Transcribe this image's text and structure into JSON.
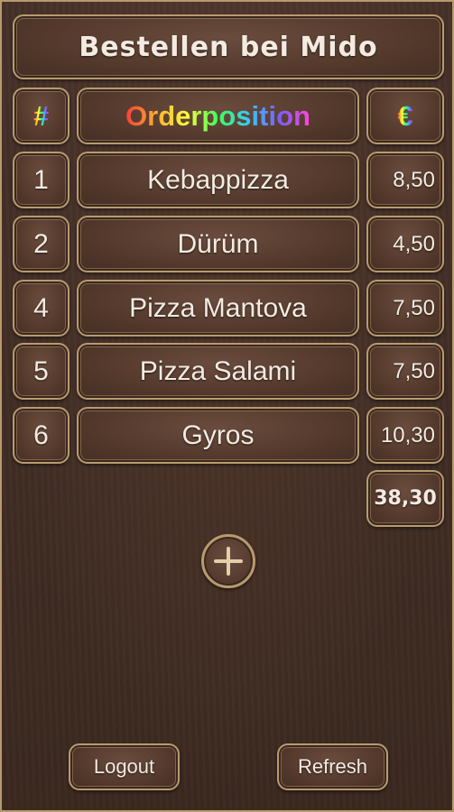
{
  "title": "Bestellen bei Mido",
  "headers": {
    "number": "#",
    "item": "Orderposition",
    "price": "€"
  },
  "rows": [
    {
      "number": "1",
      "item": "Kebappizza",
      "price": "8,50"
    },
    {
      "number": "2",
      "item": "Dürüm",
      "price": "4,50"
    },
    {
      "number": "4",
      "item": "Pizza Mantova",
      "price": "7,50"
    },
    {
      "number": "5",
      "item": "Pizza Salami",
      "price": "7,50"
    },
    {
      "number": "6",
      "item": "Gyros",
      "price": "10,30"
    }
  ],
  "total": "38,30",
  "buttons": {
    "logout": "Logout",
    "refresh": "Refresh"
  },
  "icons": {
    "add": "plus-circle-icon"
  }
}
